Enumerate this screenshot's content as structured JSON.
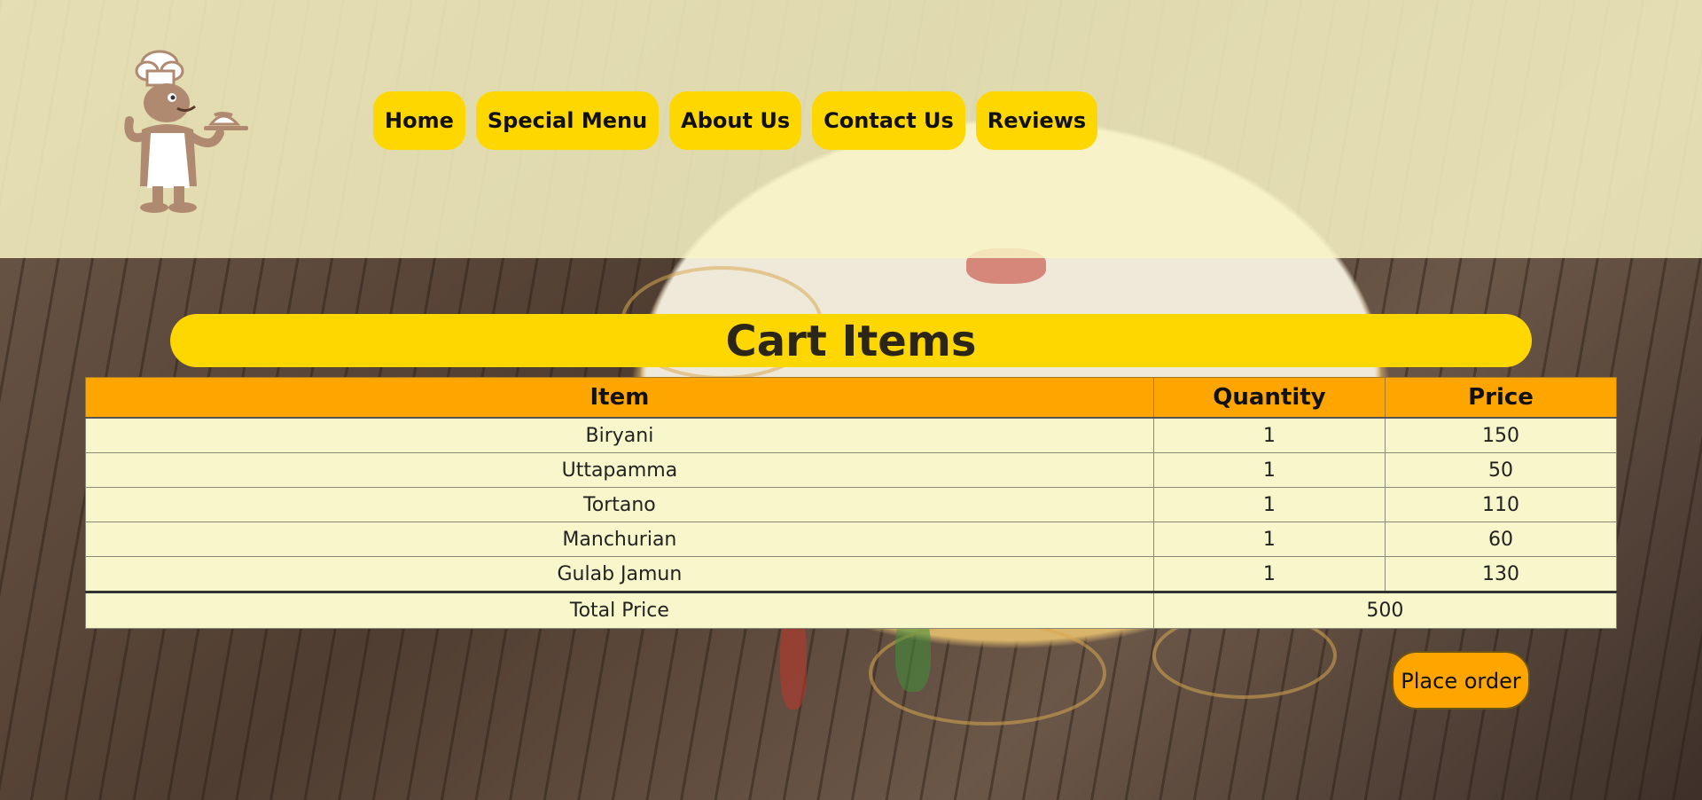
{
  "header": {
    "logo_icon": "chef-waiter-icon",
    "nav": [
      {
        "label": "Home"
      },
      {
        "label": "Special Menu"
      },
      {
        "label": "About Us"
      },
      {
        "label": "Contact Us"
      },
      {
        "label": "Reviews"
      }
    ]
  },
  "cart": {
    "title": "Cart Items",
    "columns": {
      "item": "Item",
      "quantity": "Quantity",
      "price": "Price"
    },
    "rows": [
      {
        "item": "Biryani",
        "quantity": "1",
        "price": "150"
      },
      {
        "item": "Uttapamma",
        "quantity": "1",
        "price": "50"
      },
      {
        "item": "Tortano",
        "quantity": "1",
        "price": "110"
      },
      {
        "item": "Manchurian",
        "quantity": "1",
        "price": "60"
      },
      {
        "item": "Gulab Jamun",
        "quantity": "1",
        "price": "130"
      }
    ],
    "total_label": "Total Price",
    "total_value": "500",
    "order_button": "Place order"
  },
  "colors": {
    "nav_button": "#ffd700",
    "table_header": "#ffa500",
    "table_body": "#f8f7cb",
    "header_overlay": "#f8f3c4"
  }
}
